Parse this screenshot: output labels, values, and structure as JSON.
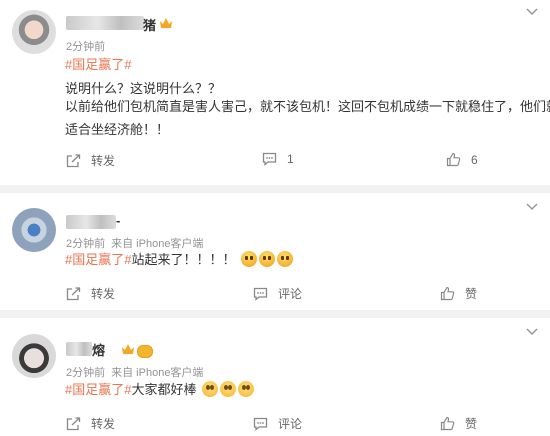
{
  "posts": [
    {
      "username_tail": "猪",
      "time": "2分钟前",
      "source": "",
      "topic": "#国足赢了#",
      "lines": [
        "说明什么？这说明什么？？",
        "以前给他们包机简直是害人害己，就不该包机！这回不包机成绩一下就稳住了，他们就",
        "适合坐经济舱！！"
      ],
      "repost_label": "转发",
      "comment_label": "1",
      "like_label": "6"
    },
    {
      "username_tail": "-",
      "time": "2分钟前",
      "source": "来自 iPhone客户端",
      "topic": "#国足赢了#",
      "text": "站起来了！！！！",
      "repost_label": "转发",
      "comment_label": "评论",
      "like_label": "赞"
    },
    {
      "username_tail": "熔",
      "time": "2分钟前",
      "source": "来自 iPhone客户端",
      "topic": "#国足赢了#",
      "text": "大家都好棒",
      "repost_label": "转发",
      "comment_label": "评论",
      "like_label": "赞"
    }
  ],
  "icons": {
    "more": "chevron-down-icon",
    "repost": "share-icon",
    "comment": "comment-icon",
    "like": "thumbs-up-icon"
  },
  "colors": {
    "topic": "#eb7350",
    "meta": "#939393",
    "background": "#f2f2f2"
  }
}
